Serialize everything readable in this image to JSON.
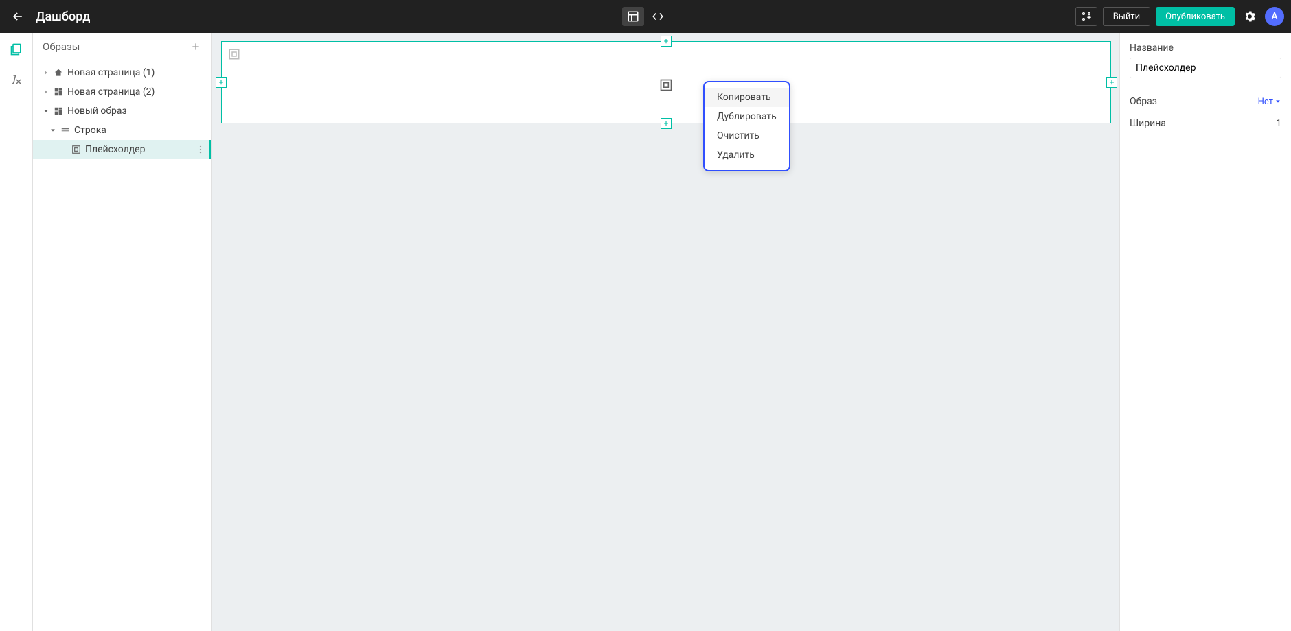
{
  "header": {
    "title": "Дашборд",
    "exit_label": "Выйти",
    "publish_label": "Опубликовать",
    "avatar_letter": "A"
  },
  "tree": {
    "header": "Образы",
    "items": [
      {
        "label": "Новая страница (1)"
      },
      {
        "label": "Новая страница (2)"
      },
      {
        "label": "Новый образ"
      },
      {
        "label": "Строка"
      },
      {
        "label": "Плейсхолдер"
      }
    ]
  },
  "context_menu": {
    "copy": "Копировать",
    "duplicate": "Дублировать",
    "clear": "Очистить",
    "delete": "Удалить"
  },
  "props": {
    "name_label": "Название",
    "name_value": "Плейсхолдер",
    "template_label": "Образ",
    "template_value": "Нет",
    "width_label": "Ширина",
    "width_value": "1"
  }
}
